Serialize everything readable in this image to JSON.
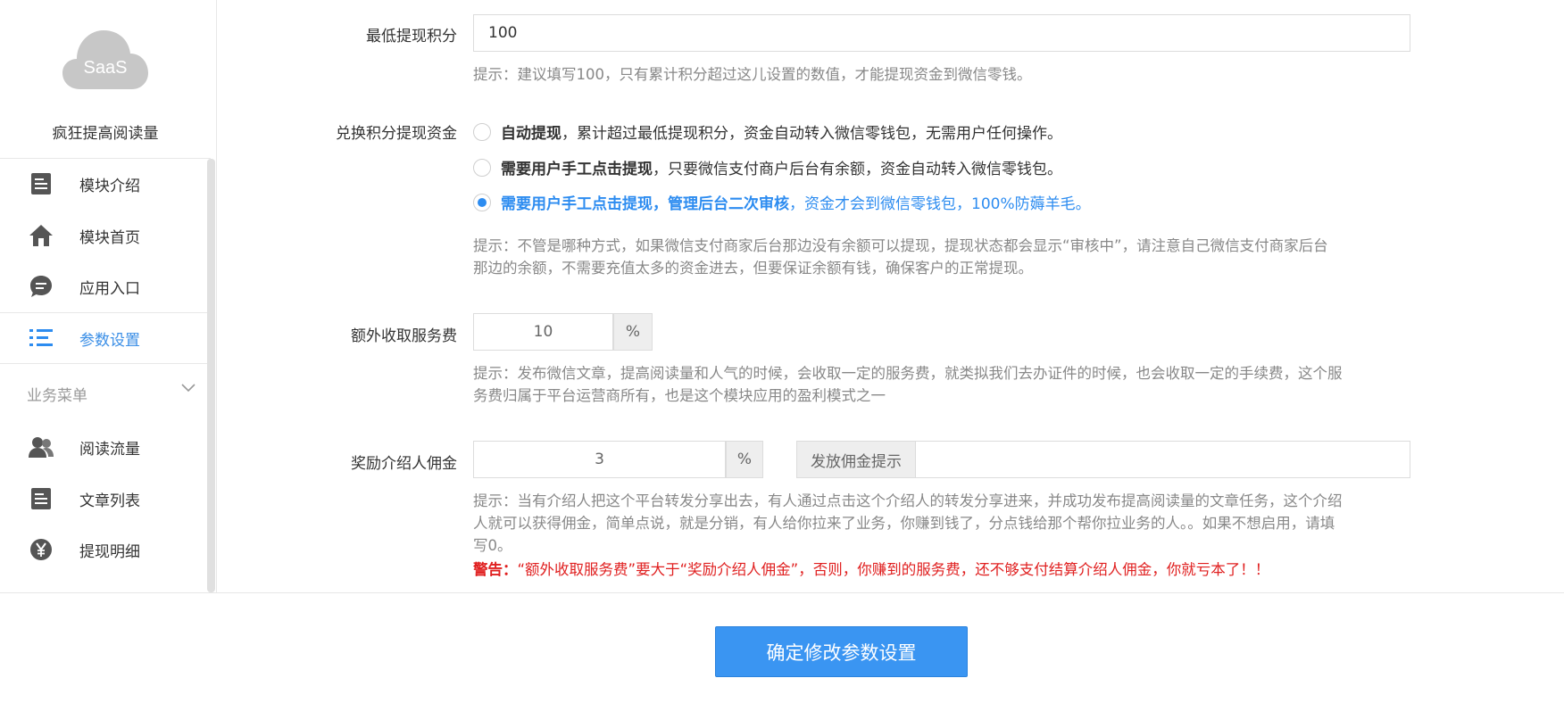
{
  "sidebar": {
    "logo_text": "SaaS",
    "brand": "疯狂提高阅读量",
    "items": [
      {
        "label": "模块介绍",
        "icon": "document-icon"
      },
      {
        "label": "模块首页",
        "icon": "home-icon"
      },
      {
        "label": "应用入口",
        "icon": "chat-bubble-icon"
      },
      {
        "label": "参数设置",
        "icon": "list-settings-icon",
        "active": true
      }
    ],
    "section_label": "业务菜单",
    "section_items": [
      {
        "label": "阅读流量",
        "icon": "users-icon"
      },
      {
        "label": "文章列表",
        "icon": "document-icon"
      },
      {
        "label": "提现明细",
        "icon": "yen-icon"
      }
    ]
  },
  "form": {
    "min_points": {
      "label": "最低提现积分",
      "value": "100",
      "hint": "提示：建议填写100，只有累计积分超过这儿设置的数值，才能提现资金到微信零钱。"
    },
    "withdraw_mode": {
      "label": "兑换积分提现资金",
      "options": [
        {
          "bold": "自动提现",
          "rest": "，累计超过最低提现积分，资金自动转入微信零钱包，无需用户任何操作。",
          "checked": false
        },
        {
          "bold": "需要用户手工点击提现",
          "rest": "，只要微信支付商户后台有余额，资金自动转入微信零钱包。",
          "checked": false
        },
        {
          "bold": "需要用户手工点击提现，管理后台二次审核",
          "rest": "，资金才会到微信零钱包，100%防薅羊毛。",
          "checked": true
        }
      ],
      "hint_line1": "提示：不管是哪种方式，如果微信支付商家后台那边没有余额可以提现，提现状态都会显示“审核中”，请注意自己微信支付商家后台",
      "hint_line2": "那边的余额，不需要充值太多的资金进去，但要保证余额有钱，确保客户的正常提现。"
    },
    "service_fee": {
      "label": "额外收取服务费",
      "value": "10",
      "unit": "%",
      "hint_line1": "提示：发布微信文章，提高阅读量和人气的时候，会收取一定的服务费，就类拟我们去办证件的时候，也会收取一定的手续费，这个服",
      "hint_line2": "务费归属于平台运营商所有，也是这个模块应用的盈利模式之一"
    },
    "referral": {
      "label": "奖励介绍人佣金",
      "value": "3",
      "unit": "%",
      "tip_button": "发放佣金提示",
      "tip_value": "",
      "hint_line1": "提示：当有介绍人把这个平台转发分享出去，有人通过点击这个介绍人的转发分享进来，并成功发布提高阅读量的文章任务，这个介绍",
      "hint_line2": "人就可以获得佣金，简单点说，就是分销，有人给你拉来了业务，你赚到钱了，分点钱给那个帮你拉业务的人。。如果不想启用，请填",
      "hint_line3": "写0。",
      "warn_label": "警告：",
      "warn_text": "“额外收取服务费”要大于“奖励介绍人佣金”，否则，你赚到的服务费，还不够支付结算介绍人佣金，你就亏本了！！"
    }
  },
  "footer": {
    "submit_label": "确定修改参数设置"
  },
  "colors": {
    "accent": "#2d8cf0",
    "warning": "#e02020",
    "hint": "#888888"
  }
}
